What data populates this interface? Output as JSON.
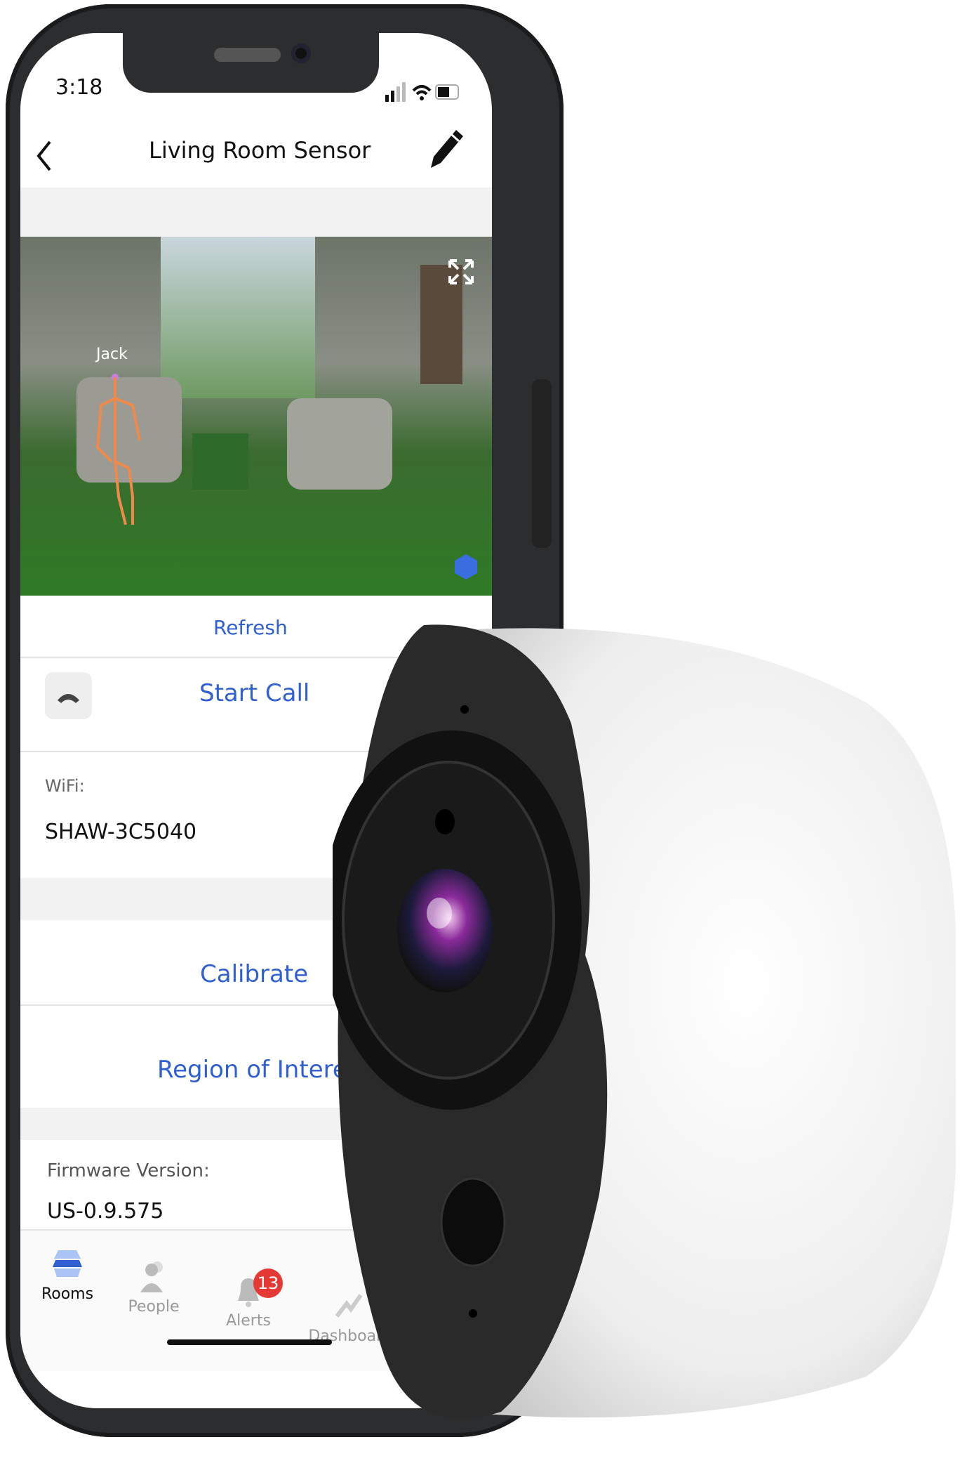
{
  "status_bar": {
    "time": "3:18"
  },
  "header": {
    "title": "Living Room Sensor",
    "back_icon": "chevron-left-icon",
    "edit_icon": "pencil-icon"
  },
  "camera_feed": {
    "person_label": "Jack",
    "expand_icon": "expand-icon",
    "logo_icon": "hexagon-logo-icon"
  },
  "actions": {
    "refresh": "Refresh",
    "start_call": "Start Call",
    "calibrate": "Calibrate",
    "region_of_interest": "Region of Interest"
  },
  "info": {
    "wifi_label": "WiFi:",
    "wifi_value": "SHAW-3C5040",
    "firmware_label": "Firmware Version:",
    "firmware_value": "US-0.9.575"
  },
  "tabs": [
    {
      "label": "Rooms",
      "icon": "layers-icon",
      "active": true
    },
    {
      "label": "People",
      "icon": "people-icon",
      "active": false
    },
    {
      "label": "Alerts",
      "icon": "bell-icon",
      "active": false,
      "badge": "13"
    },
    {
      "label": "Dashboard",
      "icon": "chart-icon",
      "active": false
    }
  ],
  "colors": {
    "accent": "#2f5fd0",
    "badge": "#e53935",
    "phone_frame": "#2b2d2f"
  }
}
